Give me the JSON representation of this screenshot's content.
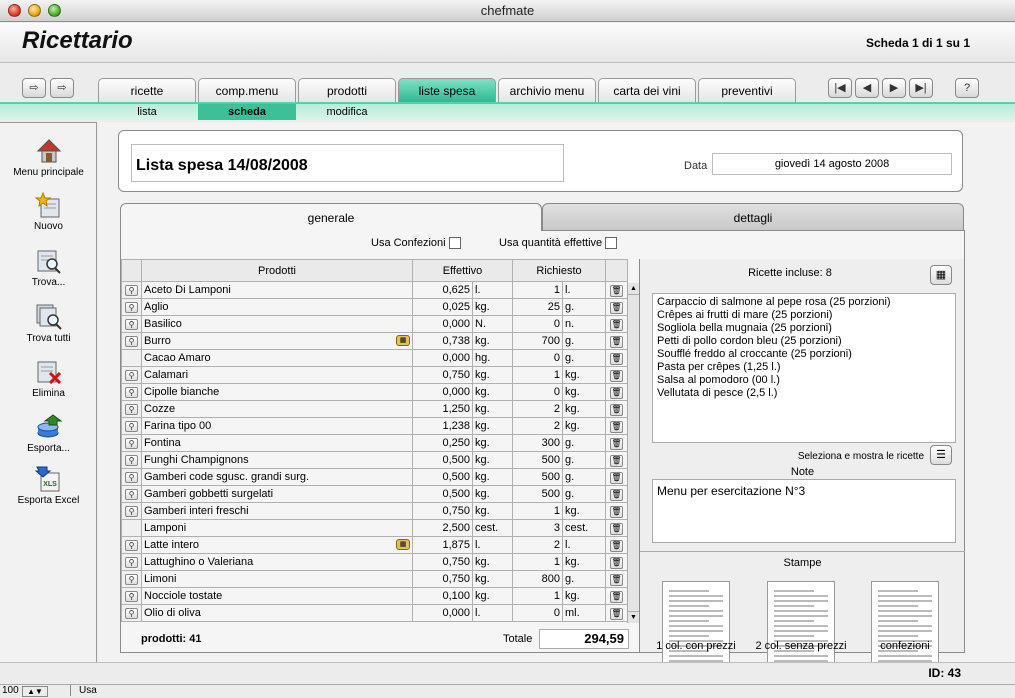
{
  "window": {
    "title": "chefmate"
  },
  "header": {
    "app_title": "Ricettario",
    "record_info": "Scheda 1 di 1 su 1"
  },
  "tabs": [
    "ricette",
    "comp.menu",
    "prodotti",
    "liste spesa",
    "archivio menu",
    "carta dei vini",
    "preventivi"
  ],
  "active_tab": "liste spesa",
  "subtabs": [
    "lista",
    "scheda",
    "modifica"
  ],
  "active_subtab": "scheda",
  "sidebar": [
    {
      "label": "Menu principale",
      "icon": "home-icon"
    },
    {
      "label": "Nuovo",
      "icon": "new-record-icon"
    },
    {
      "label": "Trova...",
      "icon": "find-icon"
    },
    {
      "label": "Trova tutti",
      "icon": "find-all-icon"
    },
    {
      "label": "Elimina",
      "icon": "delete-icon"
    },
    {
      "label": "Esporta...",
      "icon": "export-icon"
    },
    {
      "label": "Esporta Excel",
      "icon": "excel-icon",
      "badge": "XLS"
    }
  ],
  "list": {
    "title": "Lista spesa 14/08/2008",
    "date_label": "Data",
    "date_value": "giovedì 14 agosto 2008"
  },
  "section_tabs": {
    "generale": "generale",
    "dettagli": "dettagli"
  },
  "options": {
    "usa_confezioni": "Usa Confezioni",
    "usa_quantita": "Usa quantità effettive"
  },
  "columns": {
    "prodotti": "Prodotti",
    "effettivo": "Effettivo",
    "richiesto": "Richiesto"
  },
  "rows": [
    {
      "name": "Aceto Di Lamponi",
      "eff": "0,625",
      "eff_u": "l.",
      "req": "1",
      "req_u": "l.",
      "mag": true,
      "box": false
    },
    {
      "name": "Aglio",
      "eff": "0,025",
      "eff_u": "kg.",
      "req": "25",
      "req_u": "g.",
      "mag": true,
      "box": false
    },
    {
      "name": "Basilico",
      "eff": "0,000",
      "eff_u": "N.",
      "req": "0",
      "req_u": "n.",
      "mag": true,
      "box": false
    },
    {
      "name": "Burro",
      "eff": "0,738",
      "eff_u": "kg.",
      "req": "700",
      "req_u": "g.",
      "mag": true,
      "box": true
    },
    {
      "name": "Cacao Amaro",
      "eff": "0,000",
      "eff_u": "hg.",
      "req": "0",
      "req_u": "g.",
      "mag": false,
      "box": false
    },
    {
      "name": "Calamari",
      "eff": "0,750",
      "eff_u": "kg.",
      "req": "1",
      "req_u": "kg.",
      "mag": true,
      "box": false
    },
    {
      "name": "Cipolle bianche",
      "eff": "0,000",
      "eff_u": "kg.",
      "req": "0",
      "req_u": "kg.",
      "mag": true,
      "box": false
    },
    {
      "name": "Cozze",
      "eff": "1,250",
      "eff_u": "kg.",
      "req": "2",
      "req_u": "kg.",
      "mag": true,
      "box": false
    },
    {
      "name": "Farina tipo 00",
      "eff": "1,238",
      "eff_u": "kg.",
      "req": "2",
      "req_u": "kg.",
      "mag": true,
      "box": false
    },
    {
      "name": "Fontina",
      "eff": "0,250",
      "eff_u": "kg.",
      "req": "300",
      "req_u": "g.",
      "mag": true,
      "box": false
    },
    {
      "name": "Funghi Champignons",
      "eff": "0,500",
      "eff_u": "kg.",
      "req": "500",
      "req_u": "g.",
      "mag": true,
      "box": false
    },
    {
      "name": "Gamberi code sgusc. grandi surg.",
      "eff": "0,500",
      "eff_u": "kg.",
      "req": "500",
      "req_u": "g.",
      "mag": true,
      "box": false
    },
    {
      "name": "Gamberi gobbetti surgelati",
      "eff": "0,500",
      "eff_u": "kg.",
      "req": "500",
      "req_u": "g.",
      "mag": true,
      "box": false
    },
    {
      "name": "Gamberi interi freschi",
      "eff": "0,750",
      "eff_u": "kg.",
      "req": "1",
      "req_u": "kg.",
      "mag": true,
      "box": false
    },
    {
      "name": "Lamponi",
      "eff": "2,500",
      "eff_u": "cest.",
      "req": "3",
      "req_u": "cest.",
      "mag": false,
      "box": false
    },
    {
      "name": "Latte intero",
      "eff": "1,875",
      "eff_u": "l.",
      "req": "2",
      "req_u": "l.",
      "mag": true,
      "box": true
    },
    {
      "name": "Lattughino o Valeriana",
      "eff": "0,750",
      "eff_u": "kg.",
      "req": "1",
      "req_u": "kg.",
      "mag": true,
      "box": false
    },
    {
      "name": "Limoni",
      "eff": "0,750",
      "eff_u": "kg.",
      "req": "800",
      "req_u": "g.",
      "mag": true,
      "box": false
    },
    {
      "name": "Nocciole tostate",
      "eff": "0,100",
      "eff_u": "kg.",
      "req": "1",
      "req_u": "kg.",
      "mag": true,
      "box": false
    },
    {
      "name": "Olio di oliva",
      "eff": "0,000",
      "eff_u": "l.",
      "req": "0",
      "req_u": "ml.",
      "mag": true,
      "box": false
    }
  ],
  "footer": {
    "count": "prodotti: 41",
    "total_label": "Totale",
    "total_value": "294,59"
  },
  "recipes": {
    "header": "Ricette incluse: 8",
    "items": [
      "Carpaccio di salmone al pepe rosa (25 porzioni)",
      "Crêpes ai frutti di mare (25 porzioni)",
      "Sogliola bella mugnaia (25 porzioni)",
      "Petti di pollo cordon bleu (25 porzioni)",
      "Soufflé freddo al croccante (25 porzioni)",
      "Pasta per crêpes (1,25 l.)",
      "Salsa al pomodoro (00 l.)",
      "Vellutata di pesce (2,5 l.)"
    ],
    "select_label": "Seleziona e mostra le ricette"
  },
  "note": {
    "label": "Note",
    "text": "Menu per esercitazione N°3"
  },
  "prints": {
    "label": "Stampe",
    "items": [
      "1 col. con prezzi",
      "2 col. senza prezzi",
      "confezioni"
    ]
  },
  "status": {
    "id": "ID: 43",
    "zoom": "100",
    "mode": "Usa"
  }
}
